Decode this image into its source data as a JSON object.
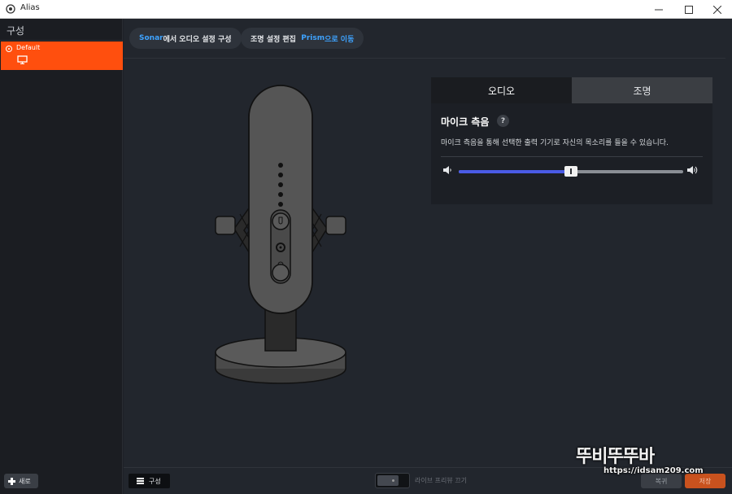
{
  "window": {
    "title": "Alias"
  },
  "sidebar": {
    "header": "구성",
    "items": [
      {
        "label": "Default"
      }
    ],
    "new_label": "새로"
  },
  "top_buttons": {
    "sonar": {
      "accent": "Sonar",
      "rest": "에서 오디오 설정 구성"
    },
    "prism": {
      "prefix": "조명 설정 편집",
      "accent": "Prism",
      "rest": "으로 이동"
    }
  },
  "panel": {
    "tabs": [
      {
        "label": "오디오",
        "active": true
      },
      {
        "label": "조명",
        "active": false
      }
    ],
    "section_title": "마이크 측음",
    "help": "?",
    "description": "마이크 측음을 통해 선택한 출력 기기로 자신의 목소리를 들을 수 있습니다.",
    "sidetone_level": 0.5
  },
  "bottom": {
    "config_label": "구성",
    "live_preview_label": "라이브 프리뷰 끄기",
    "reset_label": "복귀",
    "save_label": "저장"
  },
  "watermark": {
    "logo": "뚜비뚜뚜바",
    "url": "https://idsam209.com"
  },
  "colors": {
    "accent_orange": "#ff4f0e",
    "slider_blue": "#4a5be6",
    "link_blue": "#3ea3ff"
  }
}
